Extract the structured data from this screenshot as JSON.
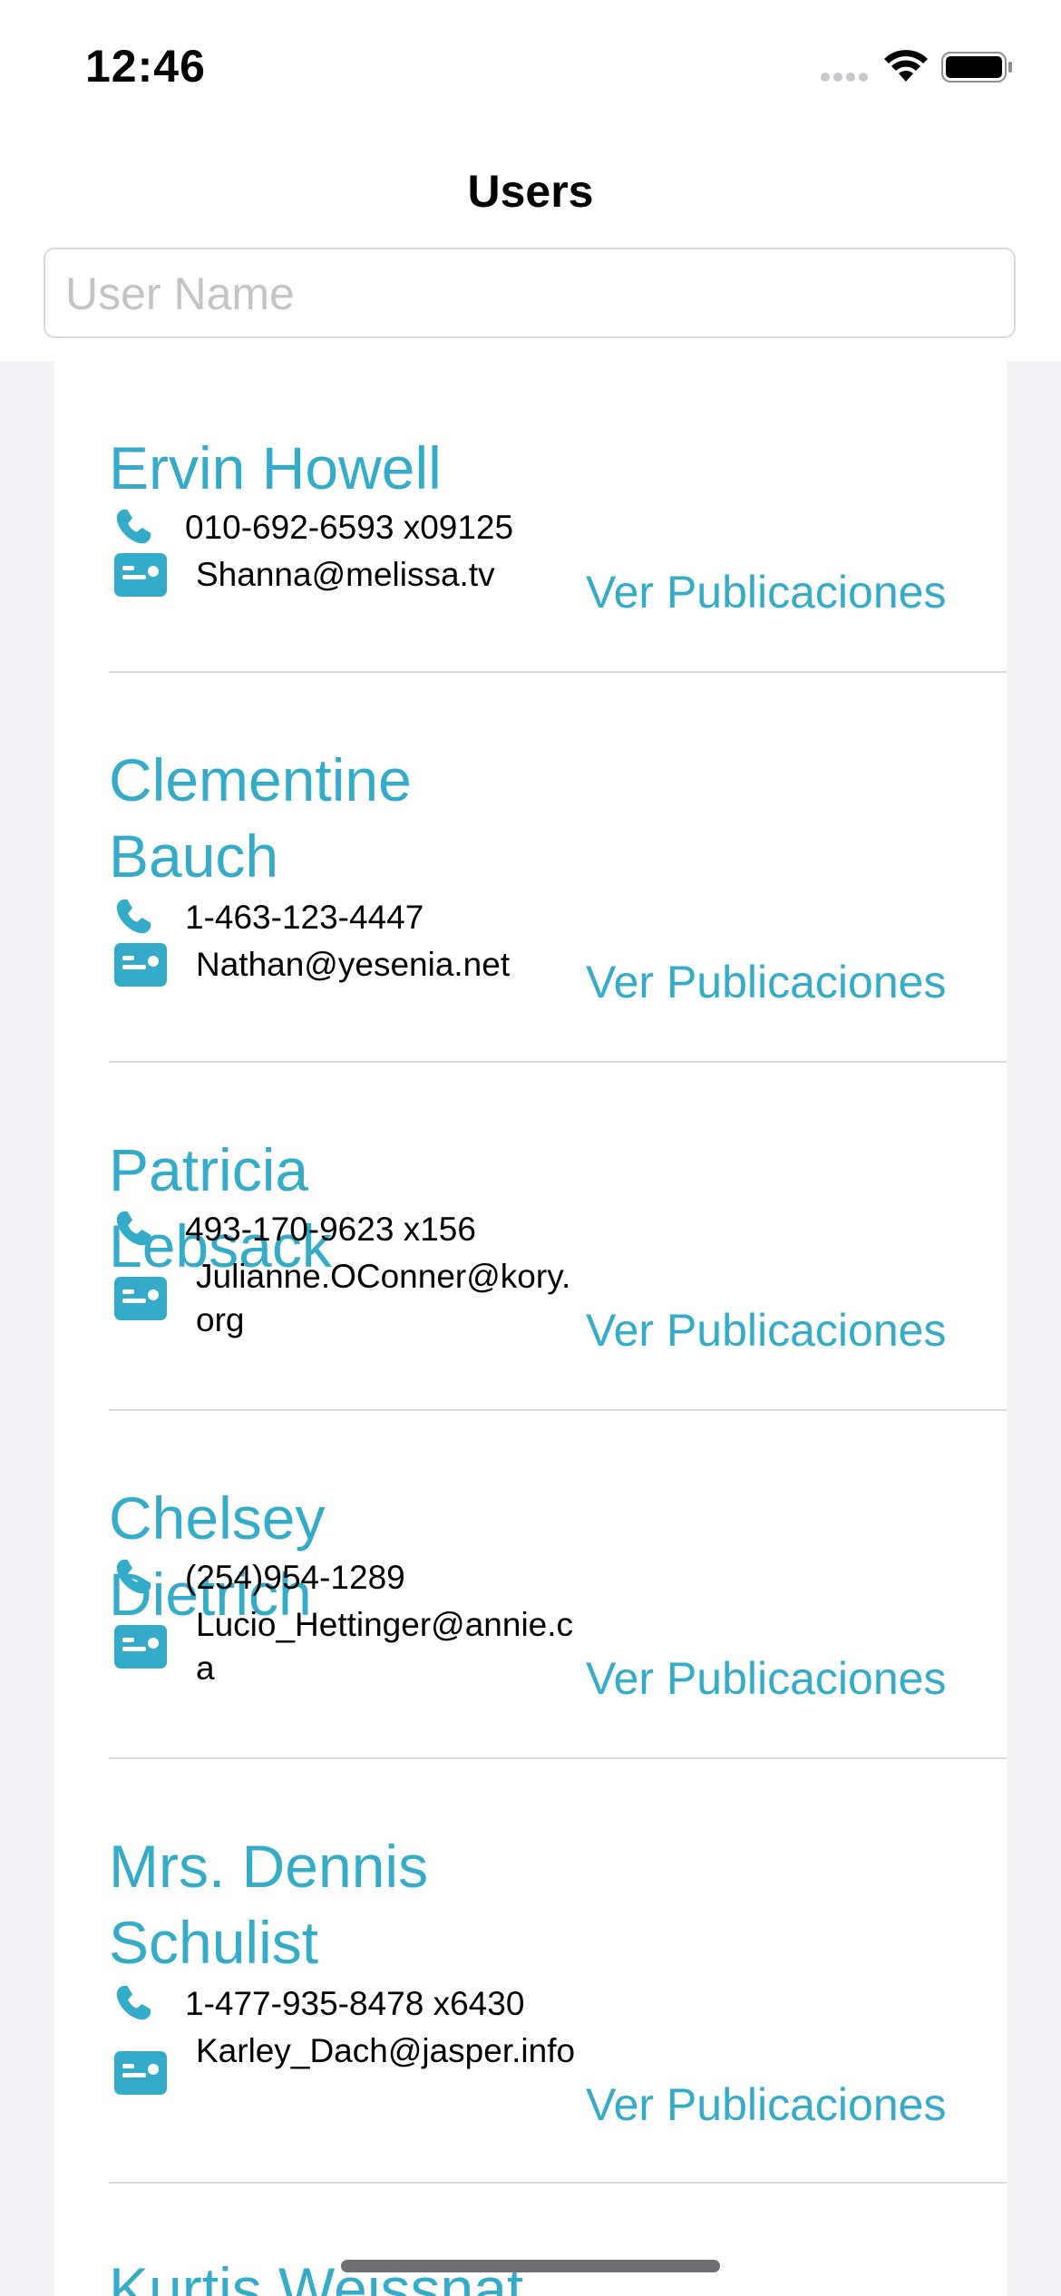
{
  "status_bar": {
    "time": "12:46"
  },
  "header": {
    "title": "Users"
  },
  "search": {
    "placeholder": "User Name",
    "value": ""
  },
  "users": [
    {
      "name": "Ervin Howell",
      "phone": "010-692-6593 x09125",
      "email": "Shanna@melissa.tv",
      "action": "Ver Publicaciones"
    },
    {
      "name": "Clementine Bauch",
      "phone": "1-463-123-4447",
      "email": "Nathan@yesenia.net",
      "action": "Ver Publicaciones"
    },
    {
      "name": "Patricia Lebsack",
      "phone": "493-170-9623 x156",
      "email": "Julianne.OConner@kory.org",
      "action": "Ver Publicaciones"
    },
    {
      "name": "Chelsey Dietrich",
      "phone": "(254)954-1289",
      "email": "Lucio_Hettinger@annie.ca",
      "action": "Ver Publicaciones"
    },
    {
      "name": "Mrs. Dennis Schulist",
      "phone": "1-477-935-8478 x6430",
      "email": "Karley_Dach@jasper.info",
      "action": "Ver Publicaciones"
    },
    {
      "name": "Kurtis Weissnat"
    }
  ],
  "colors": {
    "accent": "#33abc9",
    "background": "#f2f2f7",
    "divider": "#d9d9de"
  },
  "icons": {
    "phone": "phone-icon",
    "contact_card": "contact-card-icon"
  }
}
